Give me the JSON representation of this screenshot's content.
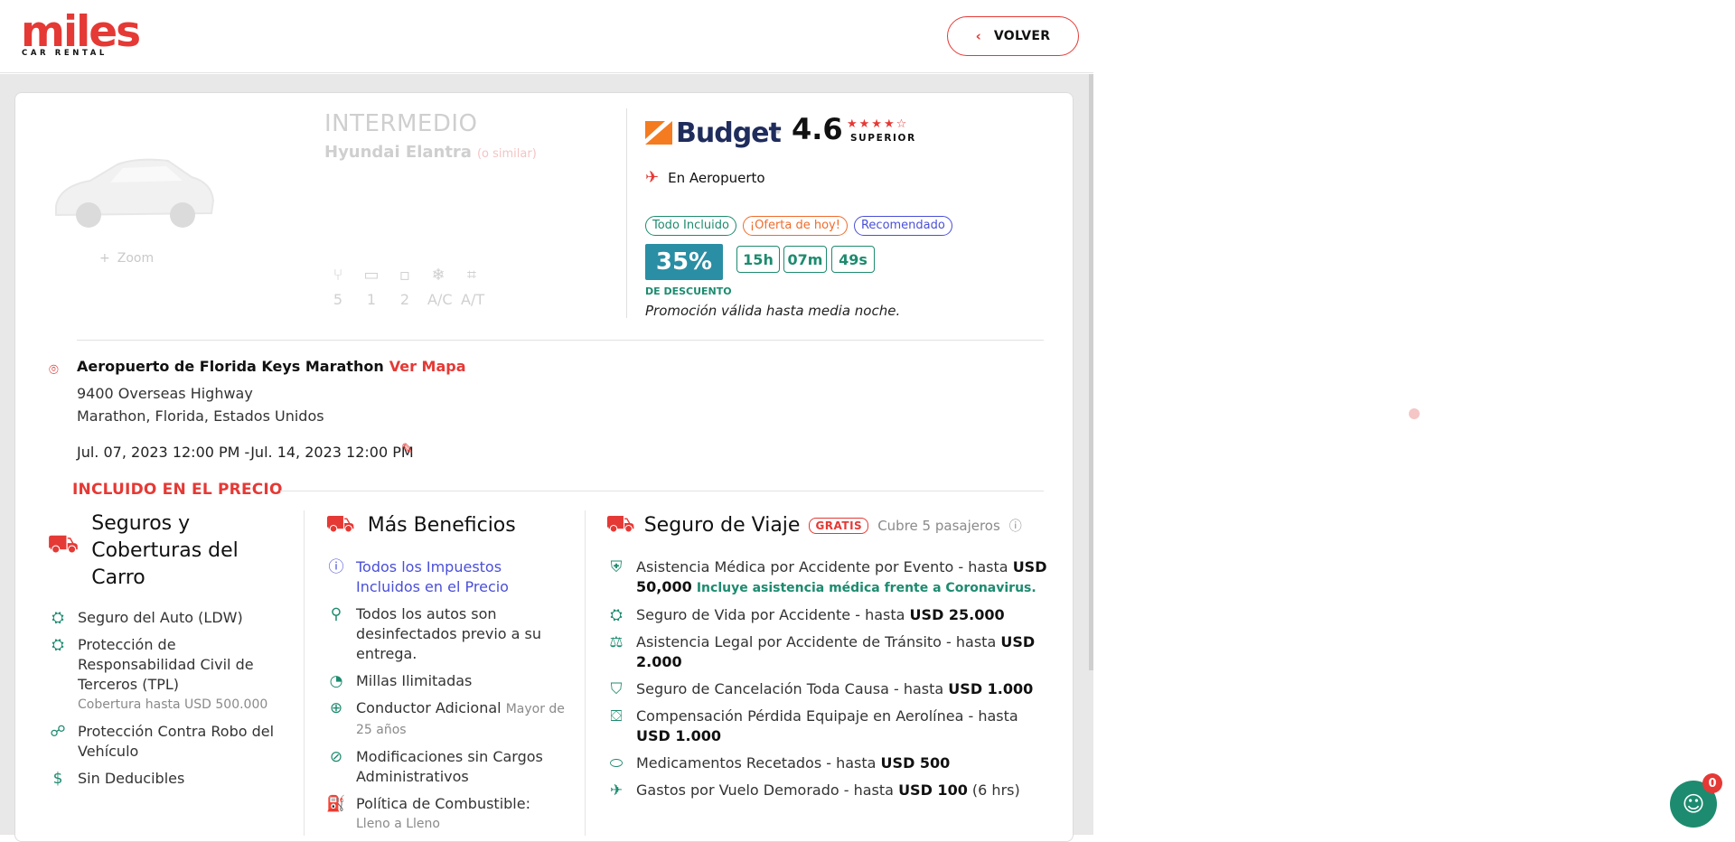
{
  "header": {
    "logo_word": "miles",
    "logo_sub": "CAR RENTAL",
    "back_label": "VOLVER"
  },
  "car": {
    "category": "INTERMEDIO",
    "model": "Hyundai Elantra",
    "similar": "(o similar)",
    "zoom": "Zoom",
    "specs": {
      "seats": "5",
      "bags_large": "1",
      "bags_small": "2",
      "ac": "A/C",
      "transmission": "A/T"
    }
  },
  "vendor": {
    "name": "Budget",
    "rating": "4.6",
    "stars": "★★★★☆",
    "rating_label": "SUPERIOR",
    "location_type": "En Aeropuerto",
    "badges": [
      "Todo Incluido",
      "¡Oferta de hoy!",
      "Recomendado"
    ],
    "discount": "35%",
    "discount_label": "DE DESCUENTO",
    "timer": {
      "hours": "15h",
      "minutes": "07m",
      "seconds": "49s"
    },
    "promo": "Promoción válida hasta media noche.",
    "colors": {
      "green": "#1d8b6f",
      "orange": "#ef6c2b",
      "blue": "#4a4fd8",
      "discount_bg": "#2a8ea4"
    }
  },
  "location": {
    "name": "Aeropuerto de Florida Keys Marathon",
    "map_link": "Ver Mapa",
    "address1": "9400 Overseas Highway",
    "address2": "Marathon, Florida, Estados Unidos",
    "dates": "Jul. 07, 2023 12:00 PM -Jul. 14, 2023 12:00 PM"
  },
  "included": {
    "heading": "INCLUIDO EN EL PRECIO",
    "insurance": {
      "title": "Seguros y Coberturas del Carro",
      "items": [
        {
          "label": "Seguro del Auto (LDW)"
        },
        {
          "label": "Protección de Responsabilidad Civil de Terceros (TPL)",
          "sub": "Cobertura hasta USD 500.000"
        },
        {
          "label": "Protección Contra Robo del Vehículo"
        },
        {
          "label": "Sin Deducibles"
        }
      ]
    },
    "benefits": {
      "title": "Más Beneficios",
      "items": [
        {
          "label": "Todos los Impuestos Incluidos en el Precio"
        },
        {
          "label": "Todos los autos son desinfectados previo a su entrega."
        },
        {
          "label": "Millas Ilimitadas"
        },
        {
          "label": "Conductor Adicional",
          "sub": "Mayor de 25 años"
        },
        {
          "label": "Modificaciones sin Cargos Administrativos"
        },
        {
          "label": "Política de Combustible:",
          "sub": "Lleno a Lleno"
        }
      ]
    },
    "travel": {
      "title": "Seguro de Viaje",
      "gratis": "GRATIS",
      "covers": "Cubre 5 pasajeros",
      "items": [
        {
          "label": "Asistencia Médica por Accidente por Evento - hasta",
          "value": "USD 50,000",
          "note": "Incluye asistencia médica frente a Coronavirus."
        },
        {
          "label": "Seguro de Vida por Accidente - hasta",
          "value": "USD 25.000"
        },
        {
          "label": "Asistencia Legal por Accidente de Tránsito - hasta",
          "value": "USD 2.000"
        },
        {
          "label": "Seguro de Cancelación Toda Causa - hasta",
          "value": "USD 1.000"
        },
        {
          "label": "Compensación Pérdida Equipaje en Aerolínea - hasta",
          "value": "USD 1.000"
        },
        {
          "label": "Medicamentos Recetados - hasta",
          "value": "USD 500"
        },
        {
          "label": "Gastos por Vuelo Demorado - hasta",
          "value": "USD 100",
          "extra": "(6 hrs)"
        }
      ]
    }
  },
  "chat": {
    "badge": "0"
  }
}
